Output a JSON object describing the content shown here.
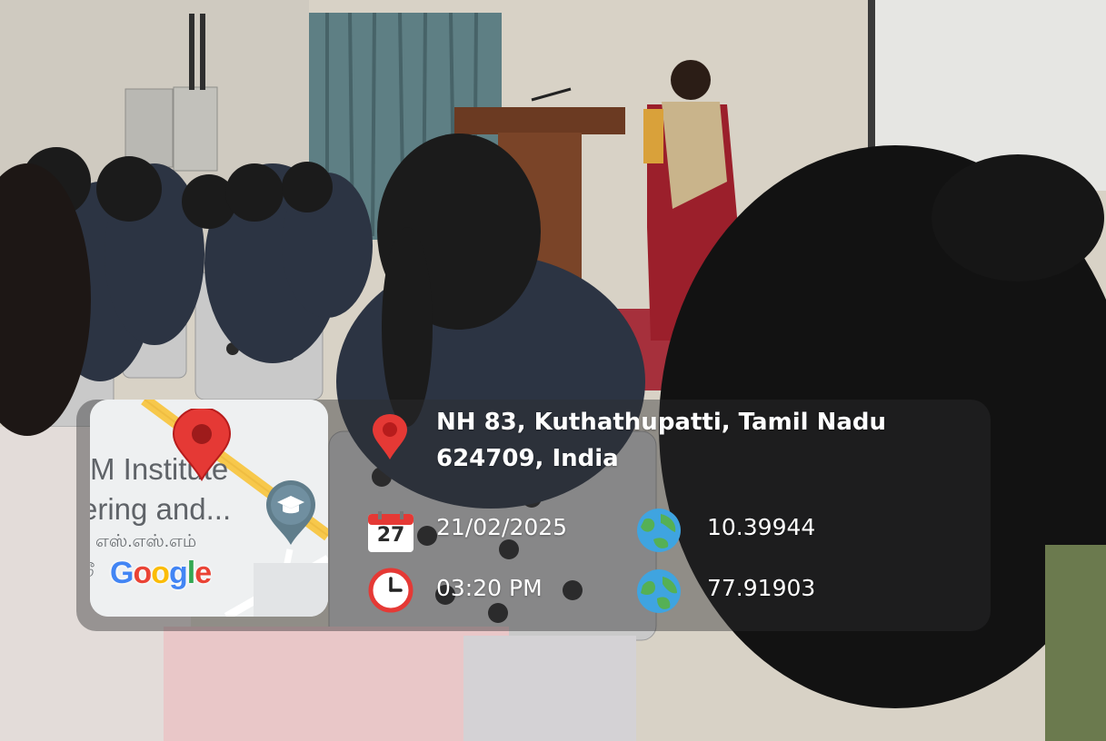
{
  "map_thumbnail": {
    "label_line1": "SM Institute",
    "label_line2": "ering and...",
    "label_line3": "எஸ்.எஸ்.எம்",
    "label_line4": "டூ",
    "logo_text": "Google",
    "pin_icon": "red-map-pin-icon",
    "place_icon": "graduation-cap-icon"
  },
  "location": {
    "address_line1": "NH 83, Kuthathupatti, Tamil Nadu",
    "address_line2": "624709, India",
    "icon": "location-pin-icon"
  },
  "date": {
    "value": "21/02/2025",
    "calendar_day": "27",
    "icon": "calendar-icon"
  },
  "time": {
    "value": "03:20 PM",
    "icon": "clock-icon"
  },
  "coordinates": {
    "latitude": "10.39944",
    "longitude": "77.91903",
    "icon": "globe-icon"
  },
  "colors": {
    "pin_red": "#e53935",
    "overlay": "#2d2d30",
    "text": "#ffffff",
    "google_blue": "#4285f4",
    "google_red": "#ea4335",
    "google_yellow": "#fbbc05",
    "google_green": "#34a853"
  }
}
